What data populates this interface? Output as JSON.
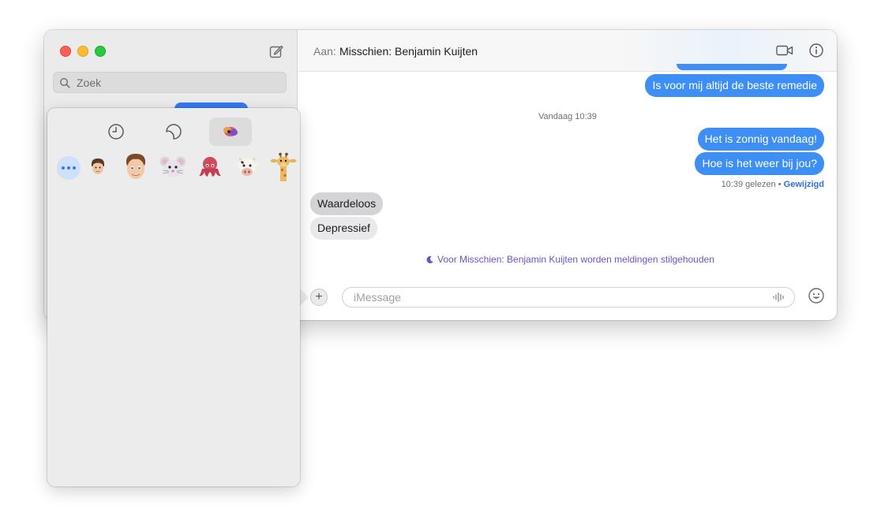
{
  "sidebar": {
    "search_placeholder": "Zoek"
  },
  "header": {
    "to_label": "Aan:",
    "recipient": "Misschien: Benjamin Kuijten"
  },
  "messages": {
    "sent_1": "Is voor mij altijd de beste remedie",
    "timestamp": "Vandaag 10:39",
    "sent_2": "Het is zonnig vandaag!",
    "sent_3": "Hoe is het weer bij jou?",
    "receipt_read": "10:39 gelezen",
    "receipt_sep": " • ",
    "receipt_edited": "Gewijzigd",
    "received_1": "Waardeloos",
    "received_2": "Depressief",
    "focus_note": "Voor Misschien: Benjamin Kuijten worden meldingen stilgehouden"
  },
  "input": {
    "placeholder": "iMessage",
    "plus": "+"
  },
  "popover": {
    "tabs": [
      "recent-icon",
      "stickers-icon",
      "memoji-icon"
    ],
    "active_tab": "memoji",
    "memoji": [
      "memoji-person-small",
      "memoji-person-face",
      "memoji-mouse",
      "memoji-octopus",
      "memoji-cow",
      "memoji-giraffe"
    ]
  },
  "colors": {
    "sent_bubble": "#3d8ff5",
    "received_bubble": "#e9e9eb",
    "accent": "#3478f6",
    "focus": "#6d52c8"
  }
}
